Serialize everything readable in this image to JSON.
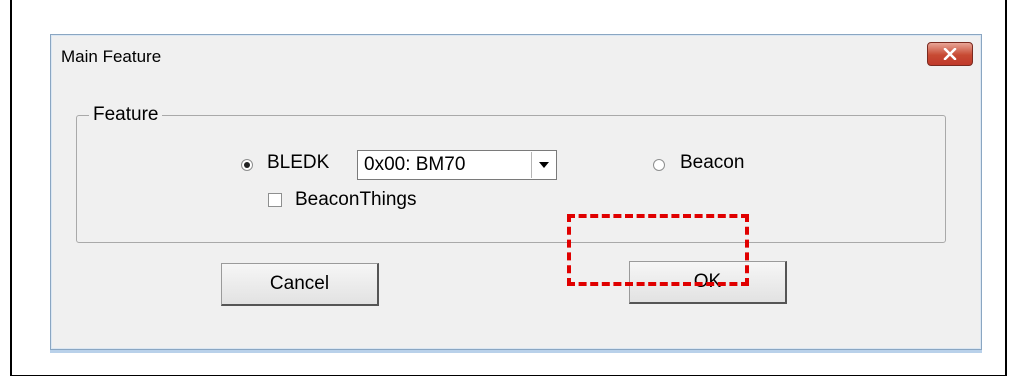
{
  "dialog": {
    "title": "Main Feature",
    "close_icon": "close-x-icon",
    "close_color": "#c74a33"
  },
  "feature_group": {
    "label": "Feature",
    "bledk": {
      "label": "BLEDK",
      "checked": true
    },
    "device_select": {
      "value": "0x00: BM70",
      "icon": "chevron-down-icon"
    },
    "beacon": {
      "label": "Beacon",
      "checked": false
    },
    "beacon_things": {
      "label": "BeaconThings",
      "checked": false
    }
  },
  "buttons": {
    "cancel_label": "Cancel",
    "ok_label": "OK"
  },
  "annotation": {
    "highlight_color": "#e00000",
    "style": "dashed"
  }
}
